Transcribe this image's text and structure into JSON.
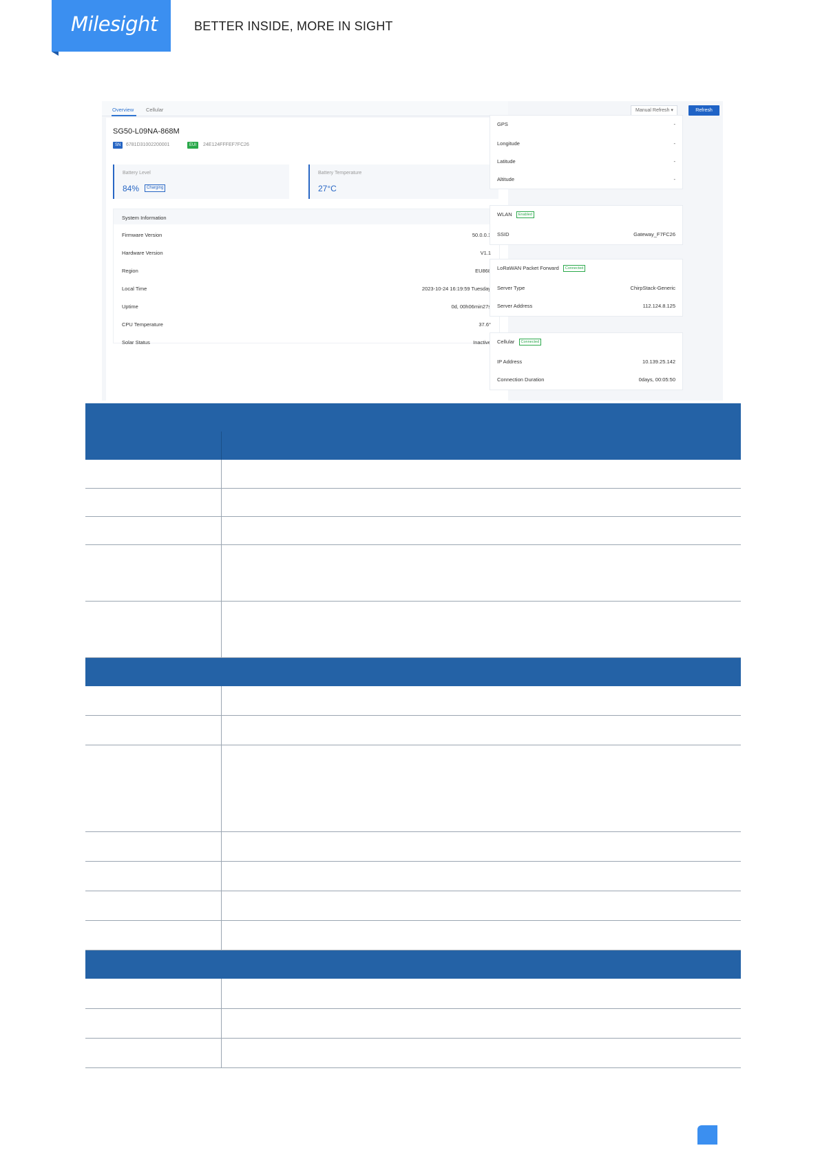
{
  "header": {
    "logo": "Milesight",
    "tagline": "BETTER INSIDE, MORE IN SIGHT"
  },
  "screenshot": {
    "tabs": [
      "Overview",
      "Cellular"
    ],
    "refresh_mode": "Manual Refresh",
    "refresh_button": "Refresh",
    "device_name": "SG50-L09NA-868M",
    "sn_tag": "SN",
    "sn_value": "6781D31002200001",
    "eui_tag": "EUI",
    "eui_value": "24E124FFFEF7FC26",
    "battery_level_label": "Battery Level",
    "battery_level_value": "84%",
    "battery_charging": "Charging",
    "battery_temp_label": "Battery Temperature",
    "battery_temp_value": "27°C",
    "system_info": {
      "title": "System Information",
      "rows": [
        {
          "key": "Firmware Version",
          "value": "50.0.0.1"
        },
        {
          "key": "Hardware Version",
          "value": "V1.1"
        },
        {
          "key": "Region",
          "value": "EU868"
        },
        {
          "key": "Local Time",
          "value": "2023-10-24 16:19:59 Tuesday"
        },
        {
          "key": "Uptime",
          "value": "0d, 00h06min27s"
        },
        {
          "key": "CPU Temperature",
          "value": "37.6°"
        },
        {
          "key": "Solar Status",
          "value": "Inactive"
        }
      ]
    },
    "gps": {
      "title": "GPS",
      "status": "-",
      "rows": [
        {
          "key": "Longitude",
          "value": "-"
        },
        {
          "key": "Latitude",
          "value": "-"
        },
        {
          "key": "Altitude",
          "value": "-"
        }
      ]
    },
    "wlan": {
      "title": "WLAN",
      "status": "Enabled",
      "rows": [
        {
          "key": "SSID",
          "value": "Gateway_F7FC26"
        }
      ]
    },
    "lorawan": {
      "title": "LoRaWAN Packet Forward",
      "status": "Connected",
      "rows": [
        {
          "key": "Server Type",
          "value": "ChirpStack-Generic"
        },
        {
          "key": "Server Address",
          "value": "112.124.8.125"
        }
      ]
    },
    "cellular": {
      "title": "Cellular",
      "status": "Connected",
      "rows": [
        {
          "key": "IP Address",
          "value": "10.139.25.142"
        },
        {
          "key": "Connection Duration",
          "value": "0days, 00:05:50"
        }
      ]
    }
  },
  "colors": {
    "brand": "#3b8ff0",
    "table_header": "#2462a6",
    "primary_button": "#1f63c6",
    "status_green": "#2aa84a"
  }
}
